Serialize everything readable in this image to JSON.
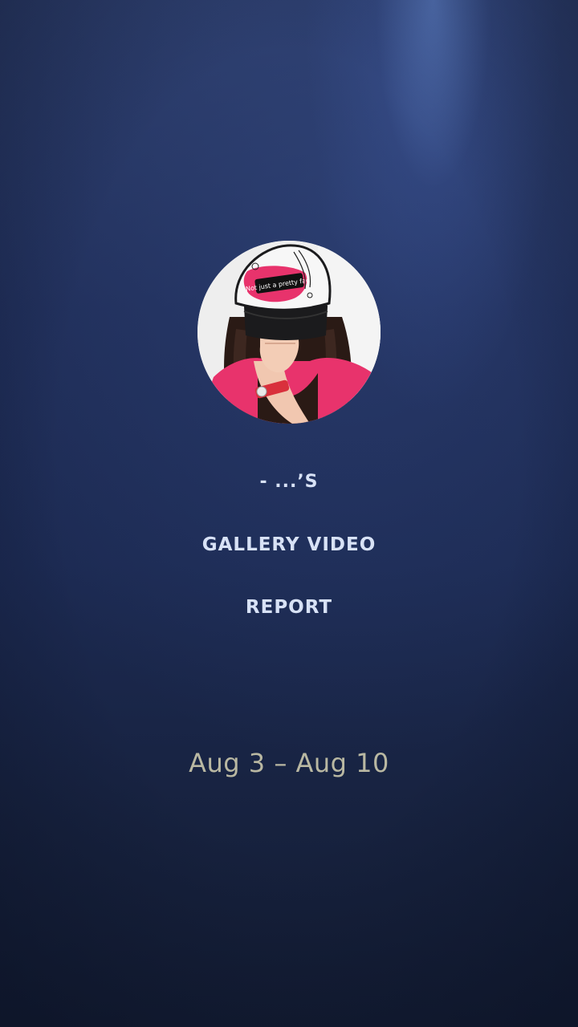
{
  "report": {
    "owner_label": "- ...’S",
    "title_line1": "GALLERY VIDEO",
    "title_line2": "REPORT",
    "date_range": "Aug 3 – Aug 10",
    "cap_text": "Not just a pretty face"
  },
  "colors": {
    "background_top": "#2a3a66",
    "background_bottom": "#131c33",
    "heading_text": "#d8e2f6",
    "date_text": "#b9b8a2",
    "shirt_pink": "#e8336c"
  }
}
